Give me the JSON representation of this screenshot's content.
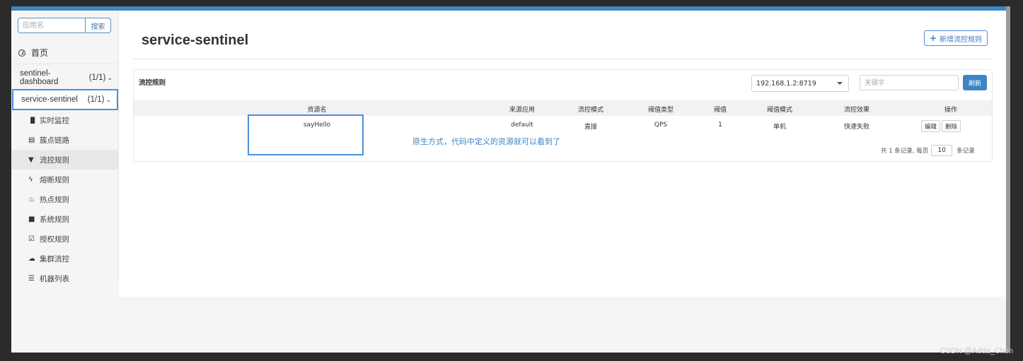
{
  "sidebar": {
    "search_placeholder": "应用名",
    "search_button": "搜索",
    "home_label": "首页",
    "apps": [
      {
        "name": "sentinel-dashboard",
        "count": "(1/1)"
      },
      {
        "name": "service-sentinel",
        "count": "(1/1)"
      }
    ],
    "menu": [
      {
        "icon": "bar-chart-icon",
        "glyph": "📶",
        "label": "实时监控"
      },
      {
        "icon": "list-alt-icon",
        "glyph": "▤",
        "label": "簇点链路"
      },
      {
        "icon": "filter-icon",
        "glyph": "▼",
        "label": "流控规则"
      },
      {
        "icon": "flash-icon",
        "glyph": "ϟ",
        "label": "熔断规则"
      },
      {
        "icon": "fire-icon",
        "glyph": "♨",
        "label": "热点规则"
      },
      {
        "icon": "lock-icon",
        "glyph": "■",
        "label": "系统规则"
      },
      {
        "icon": "check-icon",
        "glyph": "☑",
        "label": "授权规则"
      },
      {
        "icon": "cloud-icon",
        "glyph": "☁",
        "label": "集群流控"
      },
      {
        "icon": "th-list-icon",
        "glyph": "☰",
        "label": "机器列表"
      }
    ]
  },
  "main": {
    "title": "service-sentinel",
    "add_rule_button": "新增流控规则",
    "panel_title": "流控规则",
    "machine_select": "192.168.1.2:8719",
    "keyword_placeholder": "关键字",
    "refresh_button": "刷新",
    "columns": [
      "资源名",
      "来源应用",
      "流控模式",
      "阈值类型",
      "阈值",
      "阈值模式",
      "流控效果",
      "操作"
    ],
    "rows": [
      {
        "resource": "sayHello",
        "limit_app": "default",
        "strategy": "直接",
        "grade": "QPS",
        "count": "1",
        "cluster_mode": "单机",
        "control_behavior": "快速失败",
        "edit": "编辑",
        "delete": "删除"
      }
    ],
    "pager": {
      "total_text": "共 1 条记录, 每页",
      "page_size": "10",
      "unit": "条记录"
    }
  },
  "annotation": {
    "text": "原生方式，代码中定义的资源就可以看到了"
  },
  "watermark": "CSDN @Adda_Chen",
  "colors": {
    "accent": "#3e85c5",
    "annotation": "#4a90d9"
  }
}
